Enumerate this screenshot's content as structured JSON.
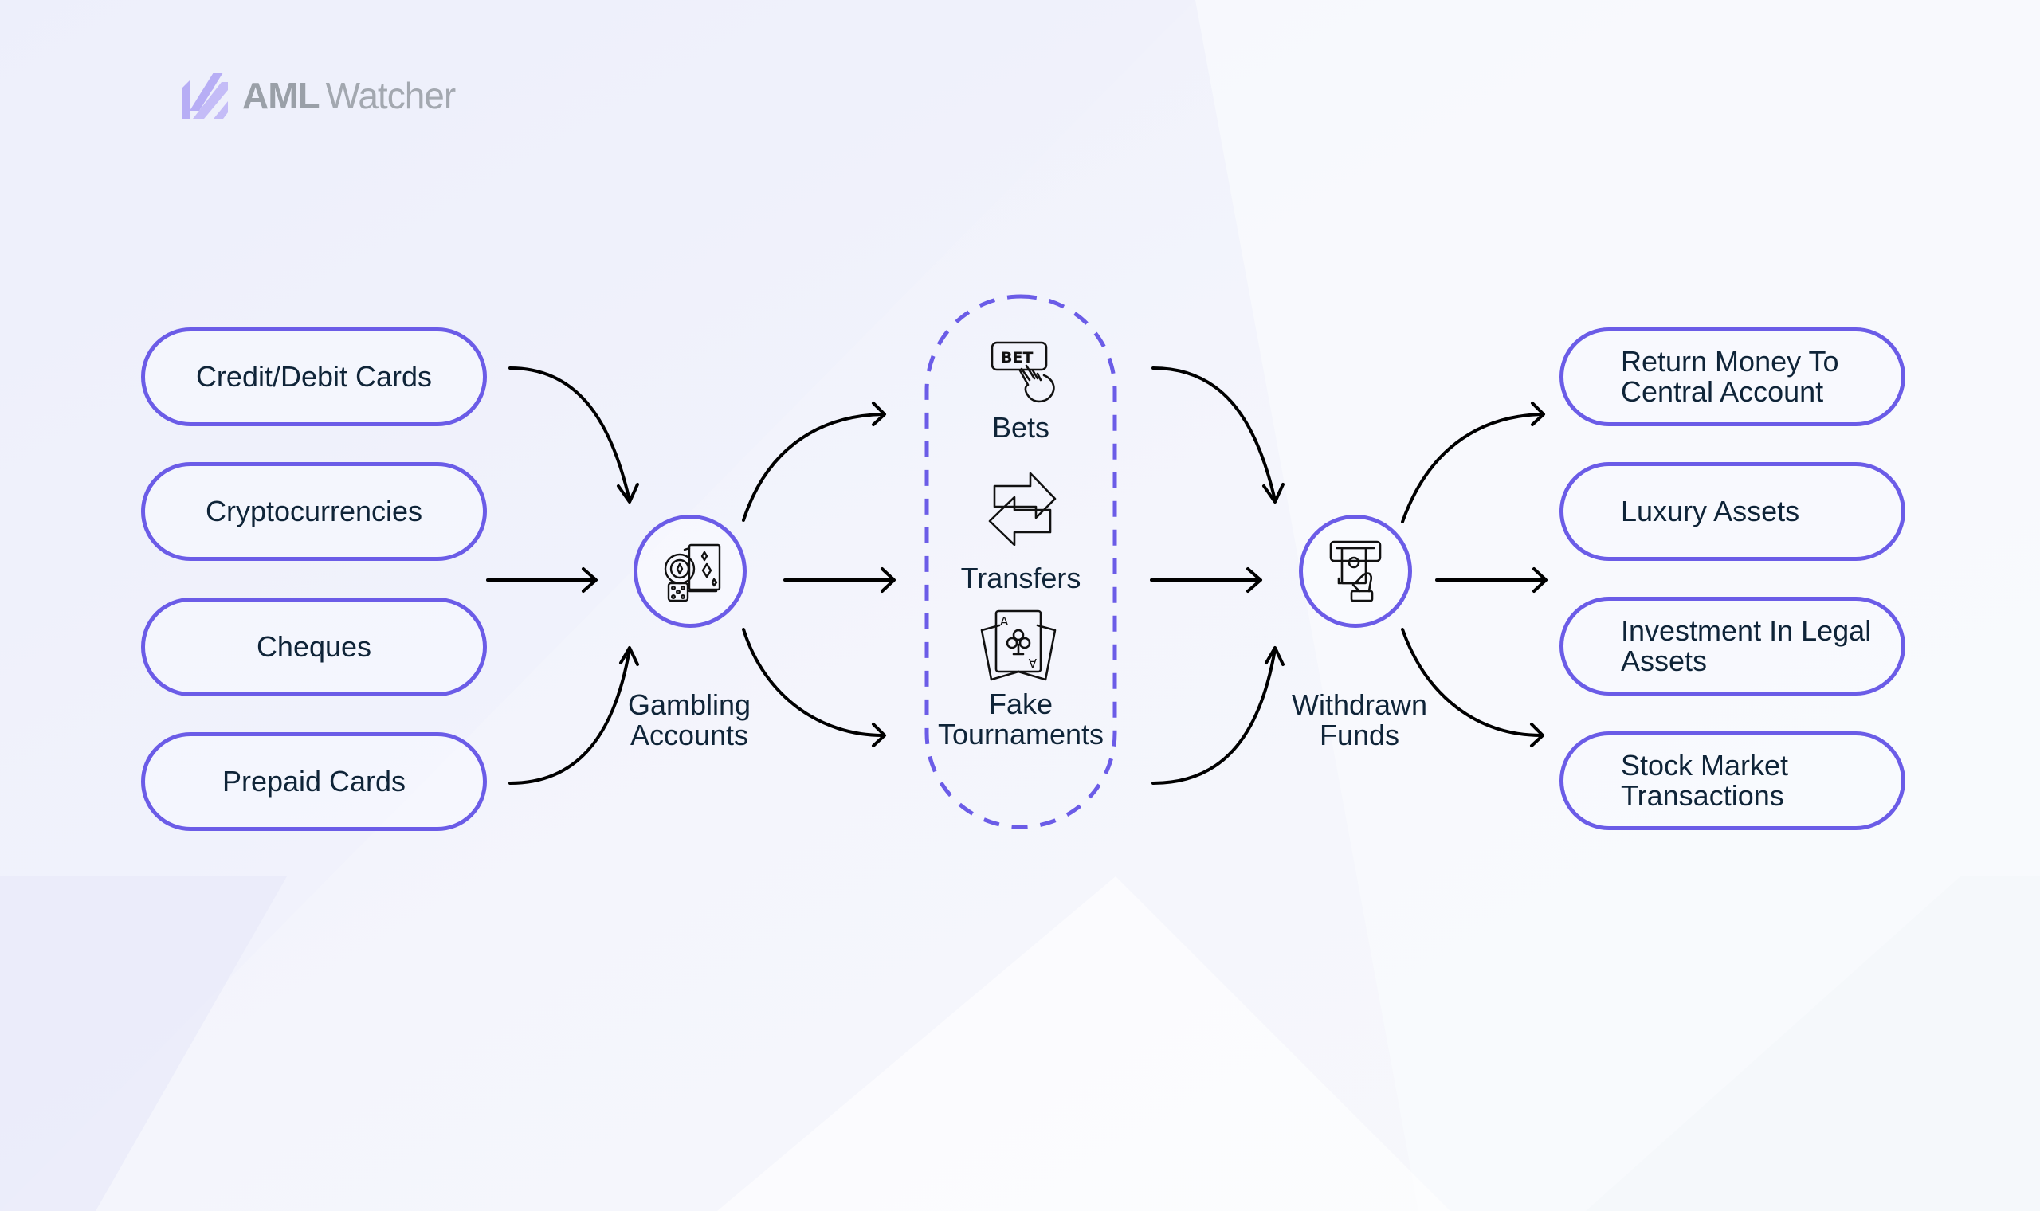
{
  "brand": {
    "name_bold": "AML",
    "name_light": "Watcher"
  },
  "colors": {
    "accent": "#6b5ce7",
    "text": "#0f2438",
    "arrow": "#000000",
    "logo_mark": "#b7aef5",
    "logo_text": "#9aa0a8"
  },
  "sources": [
    {
      "label": "Credit/Debit Cards"
    },
    {
      "label": "Cryptocurrencies"
    },
    {
      "label": "Cheques"
    },
    {
      "label": "Prepaid Cards"
    }
  ],
  "gambling_node": {
    "label_line1": "Gambling",
    "label_line2": "Accounts",
    "icon": "casino-chips-cards-dice-icon"
  },
  "methods": [
    {
      "label_line1": "Bets",
      "label_line2": "",
      "icon": "bet-button-hand-icon"
    },
    {
      "label_line1": "Transfers",
      "label_line2": "",
      "icon": "transfer-arrows-icon"
    },
    {
      "label_line1": "Fake",
      "label_line2": "Tournaments",
      "icon": "playing-cards-icon"
    }
  ],
  "withdrawn_node": {
    "label_line1": "Withdrawn",
    "label_line2": "Funds",
    "icon": "atm-cash-withdrawal-icon"
  },
  "destinations": [
    {
      "label_line1": "Return Money To",
      "label_line2": "Central Account"
    },
    {
      "label_line1": "Luxury Assets",
      "label_line2": ""
    },
    {
      "label_line1": "Investment In Legal",
      "label_line2": "Assets"
    },
    {
      "label_line1": "Stock Market",
      "label_line2": "Transactions"
    }
  ]
}
